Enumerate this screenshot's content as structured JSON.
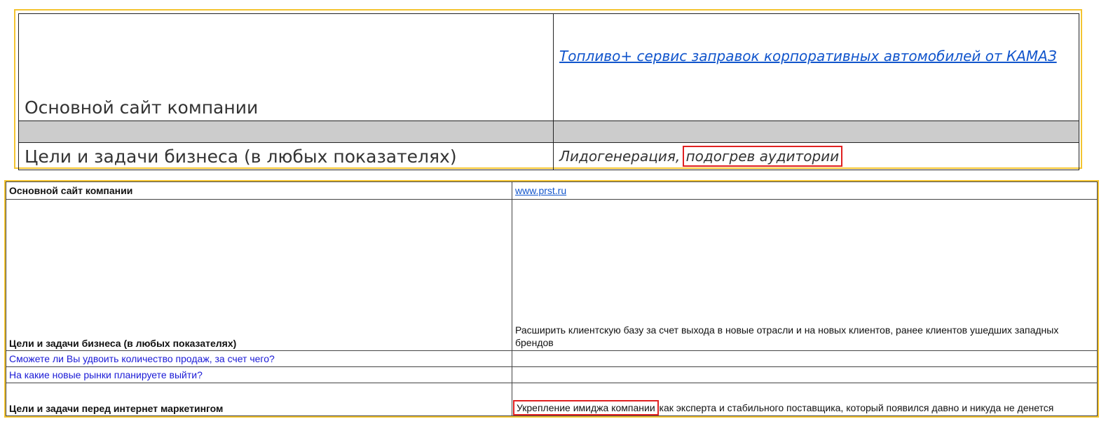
{
  "top_table": {
    "rows": [
      {
        "label": "Основной сайт компании",
        "value_link": "Топливо+ сервис заправок корпоративных автомобилей от КАМАЗ"
      },
      {
        "label": "Цели и задачи бизнеса (в любых показателях)",
        "value_plain": "Лидогенерация,",
        "value_highlight": "подогрев аудитории"
      }
    ]
  },
  "bottom_table": {
    "rows": [
      {
        "label": "Основной сайт компании",
        "value_link": "www.prst.ru"
      },
      {
        "label": "Цели и задачи бизнеса (в любых показателях)",
        "value": "Расширить клиентскую базу за счет выхода в новые отрасли и на новых клиентов, ранее клиентов ушедших западных брендов"
      },
      {
        "label": "Сможете ли Вы удвоить количество продаж, за счет чего?",
        "value": ""
      },
      {
        "label": "На какие новые рынки планируете выйти?",
        "value": ""
      },
      {
        "label": "Цели и задачи перед интернет маркетингом",
        "value_highlight": "Укрепление имиджа компании",
        "value_rest": "как эксперта и стабильного поставщика, который появился давно и никуда не денется"
      }
    ]
  },
  "colors": {
    "frame": "#f4c430",
    "highlight_box": "#e02020",
    "link": "#1155cc",
    "question_text": "#1a1ad6",
    "separator_row": "#cccccc"
  }
}
